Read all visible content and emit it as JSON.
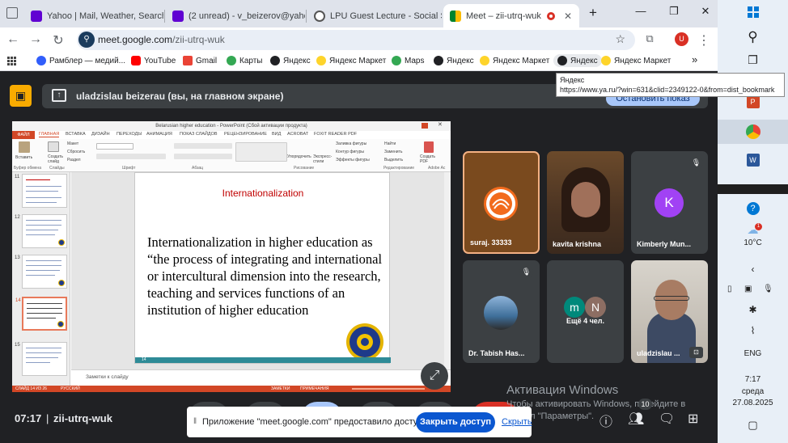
{
  "tabs": [
    {
      "label": "Yahoo | Mail, Weather, Search",
      "color": "#6001d2"
    },
    {
      "label": "(2 unread) - v_beizerov@yaho",
      "color": "#6001d2"
    },
    {
      "label": "LPU Guest Lecture - Social Sci",
      "color": "#555555"
    },
    {
      "label": "Meet – zii-utrq-wuk",
      "color": "#00897b"
    }
  ],
  "window_controls": {
    "min": "—",
    "max": "❐",
    "close": "✕",
    "new_tab": "+"
  },
  "address": {
    "host": "meet.google.com",
    "path": "/zii-utrq-wuk",
    "profile": "U"
  },
  "bookmarks": [
    {
      "label": "Рамблер — медий...",
      "color": "#315efb"
    },
    {
      "label": "YouTube",
      "color": "#ff0000"
    },
    {
      "label": "Gmail",
      "color": "#ea4335"
    },
    {
      "label": "Карты",
      "color": "#34a853"
    },
    {
      "label": "Яндекс",
      "color": "#202124"
    },
    {
      "label": "Яндекс Маркет",
      "color": "#fed42b"
    },
    {
      "label": "Maps",
      "color": "#34a853"
    },
    {
      "label": "Яндекс",
      "color": "#202124"
    },
    {
      "label": "Яндекс Маркет",
      "color": "#fed42b"
    },
    {
      "label": "Яндекс",
      "color": "#202124"
    },
    {
      "label": "Яндекс Маркет",
      "color": "#fed42b"
    }
  ],
  "bookmarks_more": "»",
  "tooltip": {
    "title": "Яндекс",
    "url": "https://www.ya.ru/?win=631&clid=2349122-0&from=dist_bookmark"
  },
  "presenting": {
    "label": "uladzislau beizerau (вы, на главном экране)",
    "stop_label": "Остановить показ"
  },
  "ppt": {
    "window_title": "Belarusian higher education - PowerPoint (Сбой активации продукта)",
    "tabs": [
      "ФАЙЛ",
      "ГЛАВНАЯ",
      "ВСТАВКА",
      "ДИЗАЙН",
      "ПЕРЕХОДЫ",
      "АНИМАЦИЯ",
      "ПОКАЗ СЛАЙДОВ",
      "РЕЦЕНЗИРОВАНИЕ",
      "ВИД",
      "ACROBAT",
      "FOXIT READER PDF"
    ],
    "ribbon": {
      "paste": "Вставить",
      "create_slide": "Создать слайд",
      "layout": "Макет",
      "reset": "Сбросить",
      "section": "Раздел",
      "arrange": "Упорядочить",
      "express_styles": "Экспресс-стили",
      "fill": "Заливка фигуры",
      "outline": "Контур фигуры",
      "effects": "Эффекты фигуры",
      "find": "Найти",
      "replace": "Заменить",
      "select": "Выделить",
      "create_pdf": "Создать PDF"
    },
    "groups": [
      "Буфер обмена",
      "Слайды",
      "Шрифт",
      "Абзац",
      "Рисование",
      "Редактирование",
      "Adobe Ac"
    ],
    "thumb_numbers": [
      "11",
      "12",
      "13",
      "14",
      "15"
    ],
    "notes_placeholder": "Заметки к слайду",
    "status": {
      "slide": "СЛАЙД 14 ИЗ 26",
      "lang": "РУССКИЙ",
      "notes": "ЗАМЕТКИ",
      "comments": "ПРИМЕЧАНИЯ"
    },
    "slide": {
      "title": "Internationalization",
      "body": "Internationalization in higher education as “the process of integrating and international or intercultural dimension into the research, teaching and services functions of an institution of higher education",
      "page": "14"
    }
  },
  "participants": [
    {
      "name": "suraj. 33333",
      "type": "logo"
    },
    {
      "name": "kavita krishna",
      "type": "video"
    },
    {
      "name": "Kimberly Mun...",
      "type": "avatar",
      "initial": "K",
      "color": "#a142f4",
      "muted": true
    },
    {
      "name": "Dr. Tabish Has...",
      "type": "photo",
      "muted": true
    },
    {
      "name": "Ещё 4 чел.",
      "type": "more",
      "initials": [
        "m",
        "N"
      ]
    },
    {
      "name": "uladzislau ...",
      "type": "video"
    }
  ],
  "bottom": {
    "time": "07:17",
    "code": "zii-utrq-wuk",
    "participants_count": "10"
  },
  "share_notice": {
    "grip": "‖",
    "message": "Приложение \"meet.google.com\" предоставило доступ к окну.",
    "stop_label": "Закрыть доступ",
    "hide_label": "Скрыть"
  },
  "activation": {
    "title": "Активация Windows",
    "line1": "Чтобы активировать Windows, перейдите в",
    "line2": "раздел \"Параметры\"."
  },
  "taskbar": {
    "temp": "10°C",
    "lang": "ENG",
    "time": "7:17",
    "day": "среда",
    "date": "27.08.2025",
    "weather_badge": "1"
  }
}
